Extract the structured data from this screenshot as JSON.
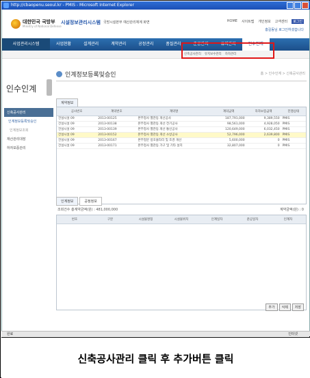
{
  "browser": {
    "title": "http://cbaopenu.seoul.kr - PMIS - Microsoft Internet Explorer",
    "status_left": "완료",
    "status_right": "인터넷"
  },
  "site": {
    "ministry": "대한민국 국방부",
    "ministry_sub": "Ministry of National Defense",
    "system": "시설정보관리시스템",
    "system_sub": "국방시설본부 예산관리체계 화면",
    "top_links": [
      "HOME",
      "사이트맵",
      "개인정보",
      "고객센터"
    ],
    "login_label": "로그인",
    "user_info": "홍길동님 로그인하셨습니다"
  },
  "nav": {
    "home_label": "사업관리시스템",
    "items": [
      "사업현황",
      "설계관리",
      "계약관리",
      "공정관리",
      "품질관리",
      "준공관리",
      "유지관리",
      "인수인계"
    ],
    "active_index": 7,
    "sub_items": [
      "신축공사관리",
      "유지보수관리",
      "하자관리"
    ]
  },
  "sidebar": {
    "title": "인수인계",
    "items": [
      {
        "label": "신축공사관리",
        "level": "active"
      },
      {
        "label": "인계정보등록및승인",
        "level": "sub"
      },
      {
        "label": "인계정보조회",
        "level": "subsub"
      },
      {
        "label": "재산관리대장",
        "level": "normal"
      },
      {
        "label": "하자보증관리",
        "level": "normal"
      }
    ]
  },
  "content": {
    "title": "인계정보등록및승인",
    "crumb": "홈 > 인수인계 > 신축공사관리",
    "tabs_top": [
      "계약정보"
    ],
    "grid1": {
      "headers": [
        "공사번호",
        "계약번호",
        "계약명",
        "계약금액",
        "하자보증금액",
        "진행상태"
      ],
      "rows": [
        [
          "건설시설 09",
          "2013-00125",
          "본부청사 별관동 개선공사",
          "187,791,000",
          "9,389,550",
          "PMIS"
        ],
        [
          "건설시설 09",
          "2013-00138",
          "본부청사 별관동 개선 전기공사",
          "98,561,000",
          "4,928,050",
          "PMIS"
        ],
        [
          "건설시설 09",
          "2013-00139",
          "본부청사 별관동 개선 통신공사",
          "120,649,000",
          "6,032,450",
          "PMIS"
        ],
        [
          "건설시설 09",
          "2013-00152",
          "본부청사 별관동 개선 소방공사",
          "52,796,000",
          "2,639,800",
          "PMIS"
        ],
        [
          "건설시설 09",
          "2013-00167",
          "본부정문 방호울타리 및 조경 개선",
          "5,600,000",
          "0",
          "PMIS"
        ],
        [
          "건설시설 09",
          "2013-00171",
          "본부청사 별관동 가구 및 기타 설치",
          "32,807,000",
          "0",
          "PMIS"
        ]
      ],
      "selected_row": 3
    },
    "tabs_bottom": [
      "인계정보",
      "공정정보"
    ],
    "toolbar_left": "조회건수  총계약금액(원) : 481,000,000",
    "toolbar_right": "계약금액(원) : 0",
    "grid2": {
      "headers": [
        "번호",
        "구분",
        "시설물명칭",
        "시설물위치",
        "인계일자",
        "준공일자",
        "인계자"
      ]
    },
    "buttons": [
      "추가",
      "삭제",
      "저장"
    ]
  },
  "caption": "신축공사관리 클릭 후 추가버튼 클릭"
}
